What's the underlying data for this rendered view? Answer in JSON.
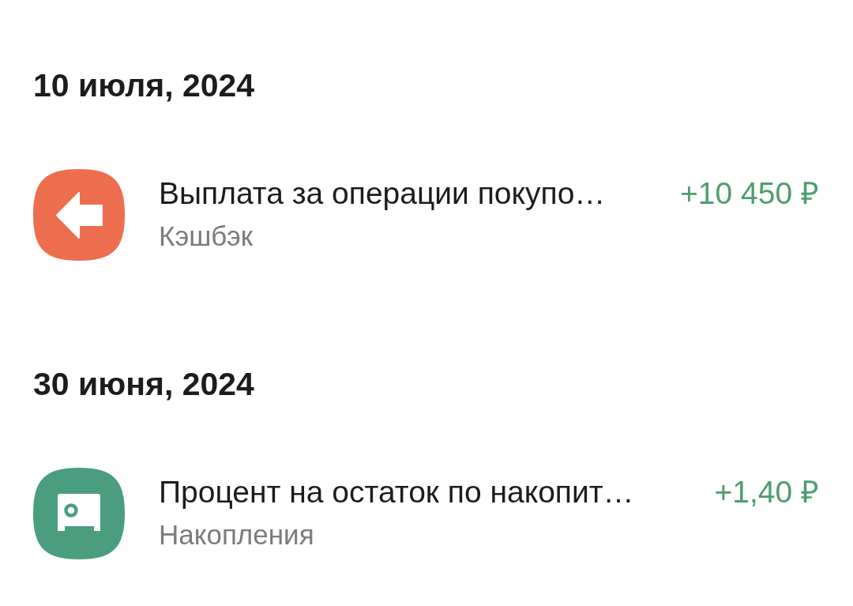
{
  "groups": [
    {
      "date": "10 июля, 2024",
      "operations": [
        {
          "kind": "cashback",
          "color": "#ec6e4f",
          "title": "Выплата за операции покупо…",
          "category": "Кэшбэк",
          "amount": "+10 450 ₽"
        }
      ]
    },
    {
      "date": "30 июня, 2024",
      "operations": [
        {
          "kind": "savings",
          "color": "#4a9e7f",
          "title": "Процент на остаток по накопит…",
          "category": "Накопления",
          "amount": "+1,40 ₽"
        }
      ]
    }
  ]
}
